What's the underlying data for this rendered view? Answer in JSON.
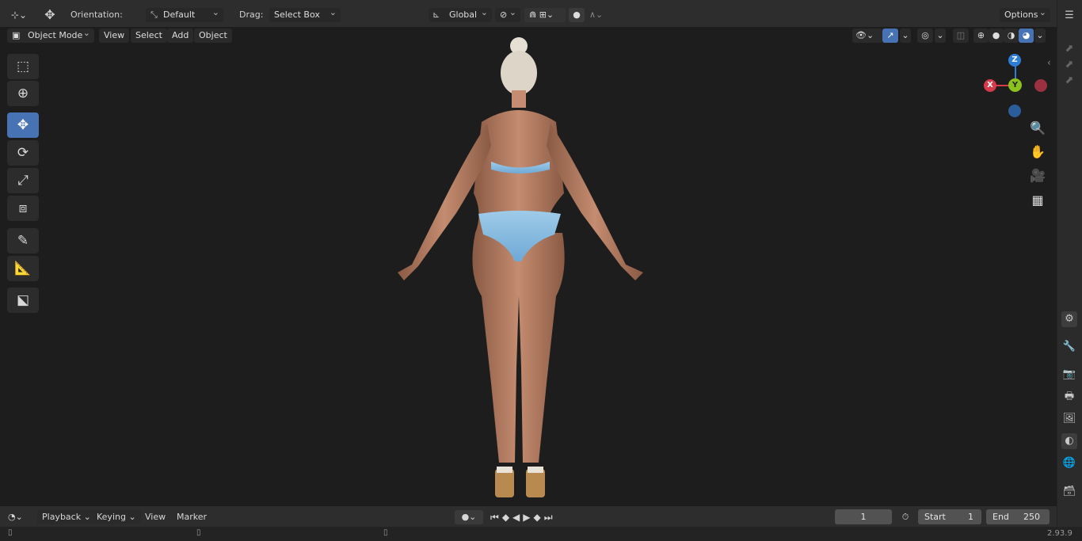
{
  "header": {
    "orientation_label": "Orientation:",
    "orientation_value": "Default",
    "drag_label": "Drag:",
    "drag_value": "Select Box",
    "transform_space": "Global",
    "options_label": "Options"
  },
  "viewport_header": {
    "mode": "Object Mode",
    "menus": [
      "View",
      "Select",
      "Add",
      "Object"
    ]
  },
  "gizmo": {
    "x": "X",
    "y": "Y",
    "z": "Z"
  },
  "timeline": {
    "menus": [
      "Playback",
      "Keying",
      "View",
      "Marker"
    ],
    "current_frame": "1",
    "start_label": "Start",
    "start_value": "1",
    "end_label": "End",
    "end_value": "250"
  },
  "status": {
    "version": "2.93.9"
  },
  "colors": {
    "accent": "#4772b3",
    "axis_x": "#d73a4a",
    "axis_y": "#8bc21c",
    "axis_z": "#2e7dd7"
  },
  "icons": {
    "editor_type": "view3d-icon",
    "transform": "move-icon",
    "snap": "magnet-icon",
    "proportional": "proportional-edit-icon",
    "overlay": "overlay-icon",
    "xray": "xray-icon",
    "shading": [
      "wireframe-icon",
      "solid-icon",
      "material-icon",
      "rendered-icon"
    ]
  }
}
